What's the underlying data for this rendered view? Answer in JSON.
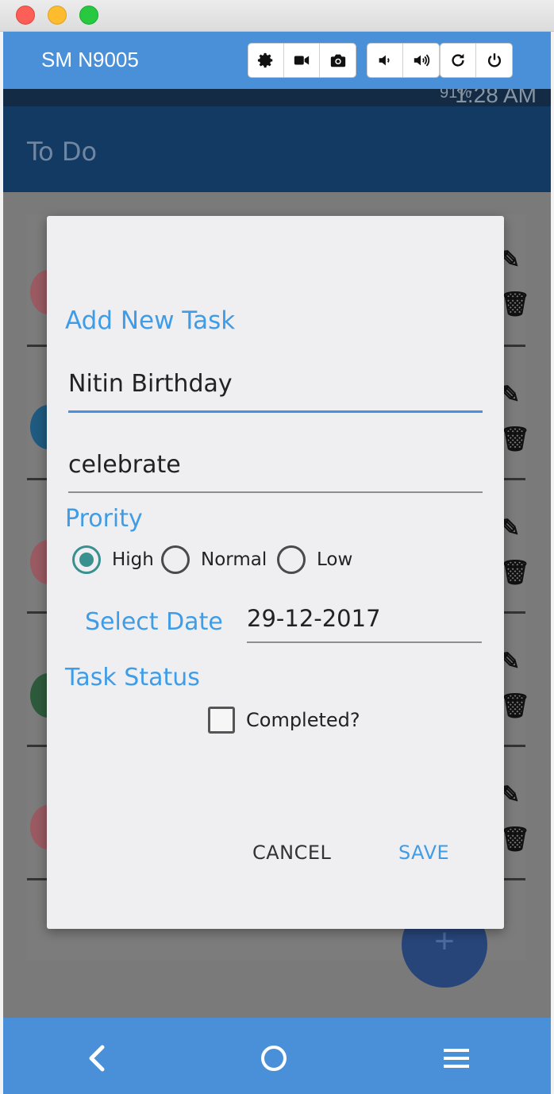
{
  "window": {
    "device_name": "SM N9005"
  },
  "emulator_toolbar": {
    "groups": [
      [
        "gear-icon",
        "video-camera-icon",
        "camera-icon"
      ],
      [
        "volume-down-icon",
        "volume-up-icon"
      ],
      [
        "rotate-icon",
        "power-icon"
      ]
    ]
  },
  "status_bar": {
    "battery": "91%",
    "time": "1:28 AM"
  },
  "app": {
    "title": "To Do"
  },
  "dialog": {
    "title": "Add New Task",
    "task_name": "Nitin Birthday",
    "task_description": "celebrate",
    "priority_label": "Prority",
    "priority_options": [
      "High",
      "Normal",
      "Low"
    ],
    "priority_selected": "High",
    "select_date_label": "Select Date",
    "date_value": "29-12-2017",
    "status_label": "Task Status",
    "completed_label": "Completed?",
    "completed_checked": false,
    "cancel_label": "CANCEL",
    "save_label": "SAVE"
  },
  "fab": {
    "label": "+"
  },
  "colors": {
    "accent": "#3f9ce6",
    "toolbar": "#4a90d9",
    "radio_selected": "#3a8f8f",
    "row_colors": [
      "#c62828",
      "#0277bd",
      "#c62828",
      "#2e7d32",
      "#c62828"
    ]
  }
}
